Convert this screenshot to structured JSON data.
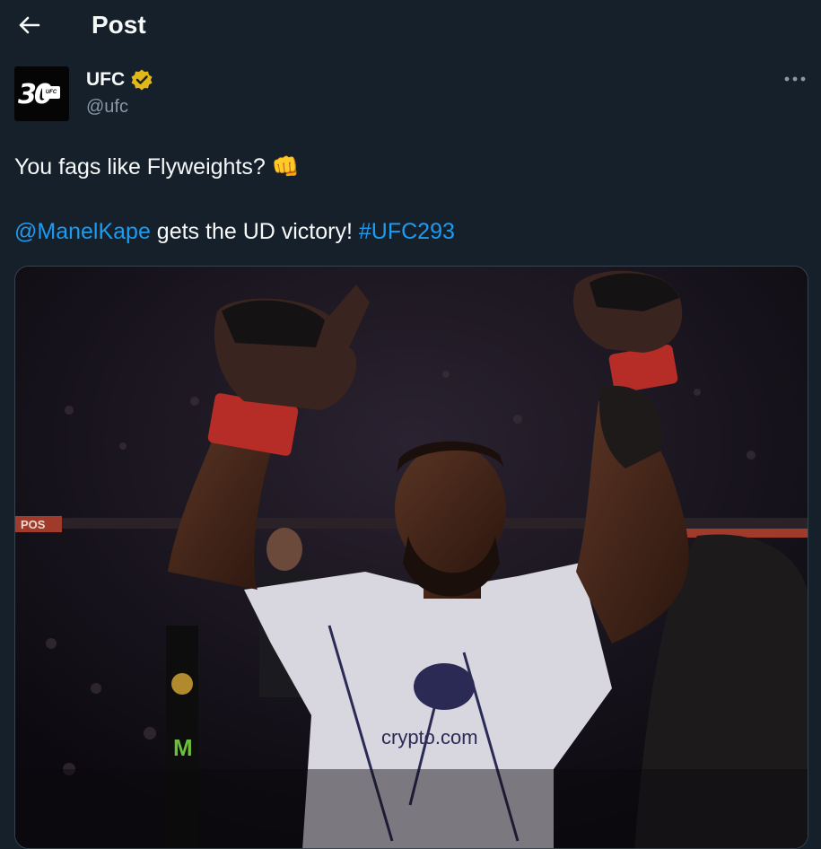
{
  "header": {
    "title": "Post"
  },
  "author": {
    "display_name": "UFC",
    "handle": "@ufc",
    "avatar_number": "30",
    "avatar_badge": "UFC",
    "verified_color": "#e2b719"
  },
  "tweet": {
    "line1_text": "You fags like Flyweights?",
    "line1_emoji": "👊",
    "mention": "@ManelKape",
    "middle_text": " gets the UD victory! ",
    "hashtag": "#UFC293"
  },
  "media": {
    "shorts_brand": "crypto.com",
    "banner_text": "POS",
    "description_icon": "photo"
  },
  "colors": {
    "background": "#15202b",
    "link": "#1d9bf0",
    "muted": "#8b98a5",
    "border": "#38444d"
  }
}
